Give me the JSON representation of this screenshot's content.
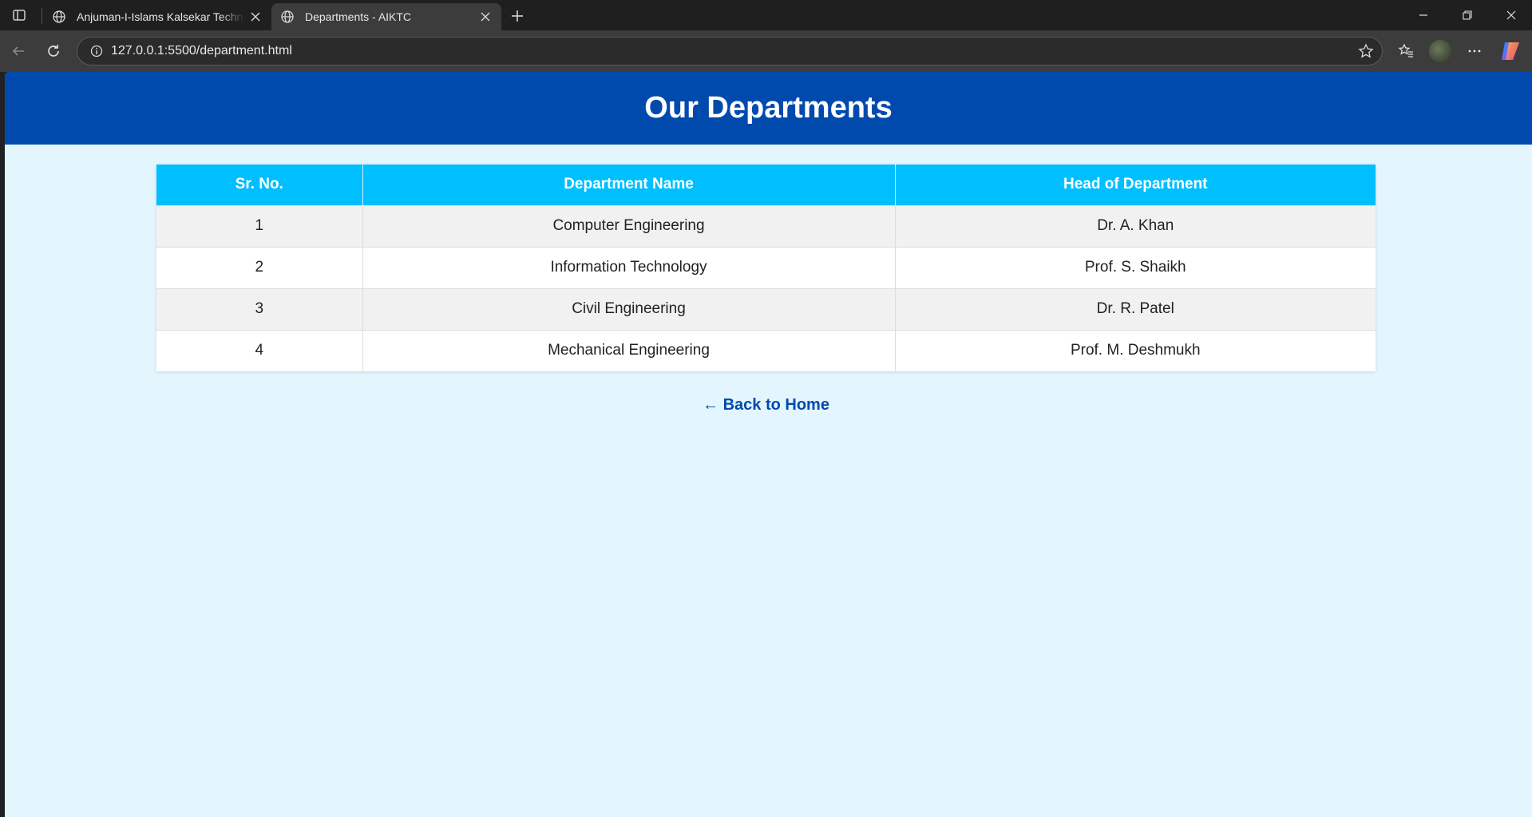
{
  "browser": {
    "tabs": [
      {
        "title": "Anjuman-I-Islams Kalsekar Technical",
        "active": false
      },
      {
        "title": "Departments - AIKTC",
        "active": true
      }
    ],
    "url": "127.0.0.1:5500/department.html"
  },
  "page": {
    "title": "Our Departments",
    "table": {
      "headers": [
        "Sr. No.",
        "Department Name",
        "Head of Department"
      ],
      "rows": [
        {
          "sr": "1",
          "name": "Computer Engineering",
          "hod": "Dr. A. Khan"
        },
        {
          "sr": "2",
          "name": "Information Technology",
          "hod": "Prof. S. Shaikh"
        },
        {
          "sr": "3",
          "name": "Civil Engineering",
          "hod": "Dr. R. Patel"
        },
        {
          "sr": "4",
          "name": "Mechanical Engineering",
          "hod": "Prof. M. Deshmukh"
        }
      ]
    },
    "back_link": "← Back to Home"
  },
  "colors": {
    "header_bg": "#004aad",
    "table_header_bg": "#00bfff",
    "page_bg": "#e3f5fd",
    "link": "#004aad"
  }
}
